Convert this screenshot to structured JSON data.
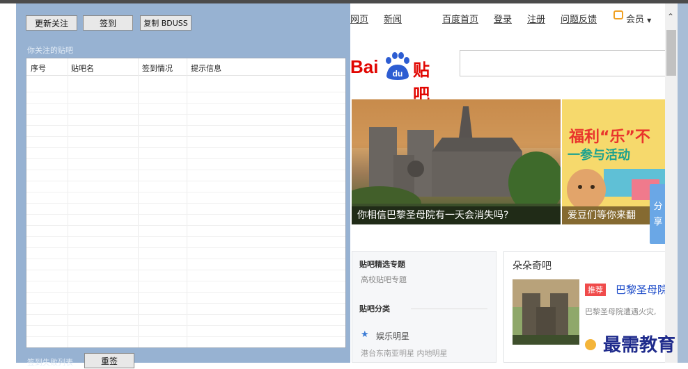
{
  "app": {
    "buttons": {
      "refresh_follow": "更新关注",
      "sign_in": "签到",
      "copy_bduss": "复制 BDUSS",
      "resign": "重签"
    },
    "followed_label": "你关注的贴吧",
    "failed_list_label": "签到失败列表",
    "table": {
      "columns": [
        "序号",
        "贴吧名",
        "签到情况",
        "提示信息"
      ],
      "rows": []
    }
  },
  "browser": {
    "nav": [
      "网页",
      "新闻",
      "百度首页",
      "登录",
      "注册",
      "问题反馈",
      "会员"
    ],
    "logo": {
      "bai": "Bai",
      "du": "du",
      "tieba": "贴吧"
    },
    "search_value": "",
    "slides": [
      {
        "caption": "你相信巴黎圣母院有一天会消失吗?"
      },
      {
        "caption": "爱豆们等你来翻",
        "headline": "福利“乐”不",
        "subline": "一参与活动"
      }
    ],
    "share_label": [
      "分",
      "享"
    ],
    "featured": {
      "title": "贴吧精选专题",
      "link": "高校贴吧专题",
      "category_title": "贴吧分类",
      "category_name": "娱乐明星",
      "category_links": "港台东南亚明星  内地明星"
    },
    "recommend": {
      "title": "朵朵奇吧",
      "badge": "推荐",
      "item_title": "巴黎圣母院",
      "item_desc": "巴黎圣母院遭遇火灾,"
    }
  },
  "watermark": "最需教育",
  "colors": {
    "left_panel": "#97b2d2",
    "baidu_red": "#e10601",
    "baidu_blue": "#2d5dd2",
    "badge_red": "#f04b4b",
    "link_blue": "#1a49c8"
  }
}
